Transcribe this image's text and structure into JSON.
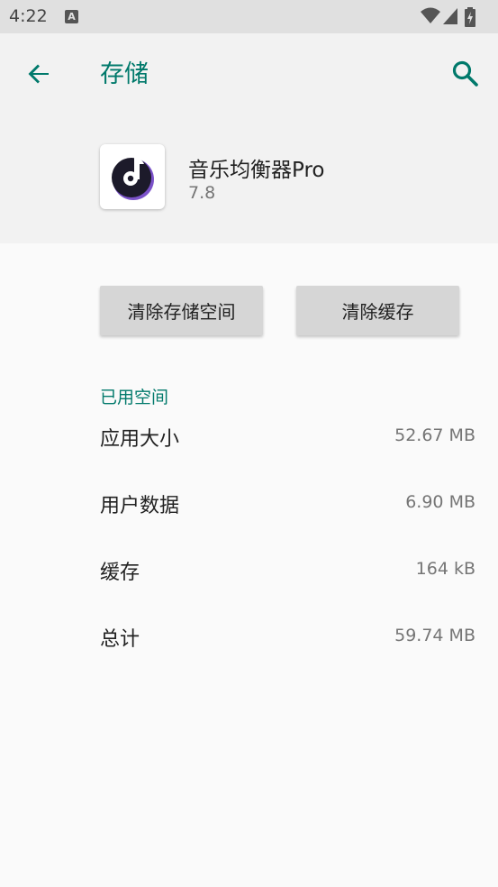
{
  "status_bar": {
    "time": "4:22",
    "notification_glyph": "A",
    "icons": [
      "notification-icon",
      "wifi-icon",
      "signal-icon",
      "battery-charging-icon"
    ]
  },
  "header": {
    "title": "存储",
    "back_icon": "arrow-back-icon",
    "search_icon": "search-icon",
    "accent_color": "#00796b"
  },
  "app": {
    "name": "音乐均衡器Pro",
    "version": "7.8",
    "icon": "music-note-icon"
  },
  "buttons": {
    "clear_storage": "清除存储空间",
    "clear_cache": "清除缓存"
  },
  "storage": {
    "section_title": "已用空间",
    "rows": [
      {
        "label": "应用大小",
        "value": "52.67 MB"
      },
      {
        "label": "用户数据",
        "value": "6.90 MB"
      },
      {
        "label": "缓存",
        "value": "164 kB"
      },
      {
        "label": "总计",
        "value": "59.74 MB"
      }
    ]
  }
}
